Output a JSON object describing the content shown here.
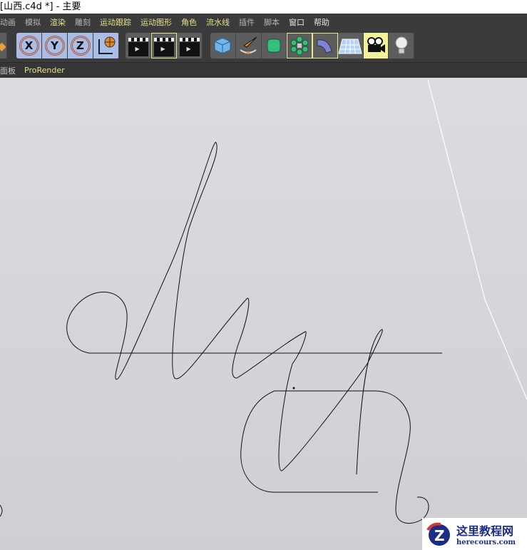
{
  "window": {
    "title": "[山西.c4d *] - 主要"
  },
  "menu": [
    {
      "label": "动画",
      "style": "gray"
    },
    {
      "label": "模拟",
      "style": "gray"
    },
    {
      "label": "渲染",
      "style": "hl"
    },
    {
      "label": "雕刻",
      "style": "gray"
    },
    {
      "label": "运动跟踪",
      "style": "hl"
    },
    {
      "label": "运动图形",
      "style": "hl"
    },
    {
      "label": "角色",
      "style": "hl"
    },
    {
      "label": "流水线",
      "style": "hl"
    },
    {
      "label": "插件",
      "style": "gray"
    },
    {
      "label": "脚本",
      "style": "gray"
    },
    {
      "label": "窗口",
      "style": "wh"
    },
    {
      "label": "帮助",
      "style": "wh"
    }
  ],
  "toolbar": {
    "x": "X",
    "y": "Y",
    "z": "Z"
  },
  "subbar": {
    "panel": "面板",
    "prorender": "ProRender"
  },
  "watermark": {
    "title": "这里教程网",
    "url": "herecours.com"
  }
}
